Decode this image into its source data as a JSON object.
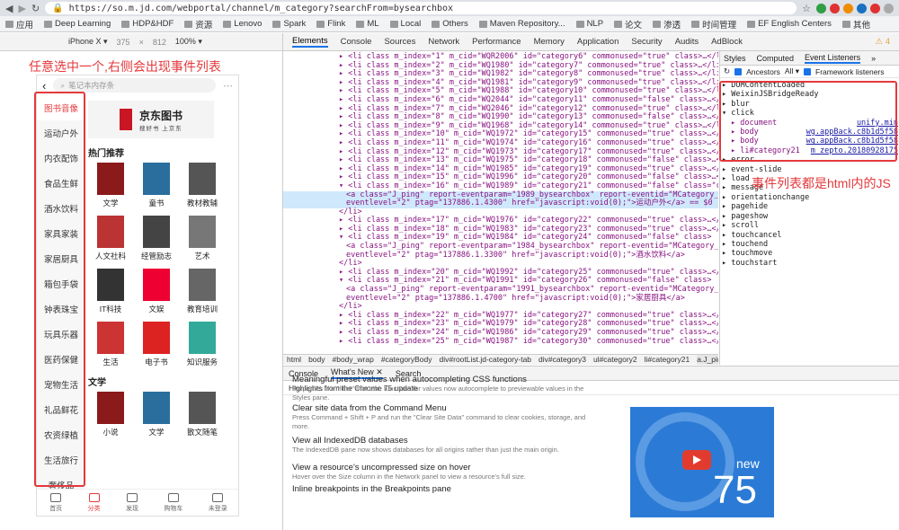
{
  "browser": {
    "url": "https://so.m.jd.com/webportal/channel/m_category?searchFrom=bysearchbox"
  },
  "bookmarks": [
    "应用",
    "Deep Learning",
    "HDP&HDF",
    "资源",
    "Lenovo",
    "Spark",
    "Flink",
    "ML",
    "Local",
    "Others",
    "Maven Repository...",
    "NLP",
    "论文",
    "渗透",
    "时间管理",
    "EF English Centers",
    "其他"
  ],
  "device": {
    "name": "iPhone X ▾",
    "width": "375",
    "height": "812",
    "zoom": "100% ▾"
  },
  "annotations": {
    "left": "任意选中一个,右侧会出现事件列表",
    "right": "事件列表都是html内的JS"
  },
  "phone": {
    "search_placeholder": "笔记本内存条",
    "categories": [
      "图书音像",
      "运动户外",
      "内衣配饰",
      "食品生鲜",
      "酒水饮料",
      "家具家装",
      "家居厨具",
      "箱包手袋",
      "钟表珠宝",
      "玩具乐器",
      "医药保健",
      "宠物生活",
      "礼品鲜花",
      "农资绿植",
      "生活旅行",
      "奢侈品"
    ],
    "banner_title": "京东图书",
    "banner_sub": "搜好书 上京东",
    "hot_title": "热门推荐",
    "hot_items": [
      "文学",
      "童书",
      "教材教辅",
      "人文社科",
      "经管励志",
      "艺术",
      "IT科技",
      "文娱",
      "教育培训",
      "生活",
      "电子书",
      "知识服务"
    ],
    "lit_title": "文学",
    "lit_items": [
      "小说",
      "文学",
      "散文随笔"
    ],
    "tabbar": [
      "首页",
      "分类",
      "发现",
      "购物车",
      "未登录"
    ]
  },
  "devtools": {
    "tabs": [
      "Elements",
      "Console",
      "Sources",
      "Network",
      "Performance",
      "Memory",
      "Application",
      "Security",
      "Audits",
      "AdBlock"
    ],
    "warn": "⚠ 4",
    "styles_tabs": [
      "Styles",
      "Computed",
      "Event Listeners",
      "»"
    ],
    "ancestors_label": "Ancestors",
    "all_label": "All ▾",
    "framework_label": "Framework listeners",
    "events": [
      "DOMContentLoaded",
      "WeixinJSBridgeReady",
      "blur",
      "click"
    ],
    "click_subs": [
      {
        "el": "document",
        "src": "unify.min"
      },
      {
        "el": "body",
        "src": "wg.appBack.c8b1d5f58"
      },
      {
        "el": "body",
        "src": "wg.appBack.c8b1d5f58"
      },
      {
        "el": "li#category21",
        "src": "m_zepto.20180928175"
      }
    ],
    "events_after": [
      "error",
      "event-slide",
      "load",
      "message",
      "orientationchange",
      "pagehide",
      "pageshow",
      "scroll",
      "touchcancel",
      "touchend",
      "touchmove",
      "touchstart"
    ],
    "crumbs": [
      "html",
      "body",
      "#body_wrap",
      "#categoryBody",
      "div#rootList.jd-category-tab",
      "div#category3",
      "ul#category2",
      "li#category21",
      "a.J_ping"
    ],
    "drawer_tabs": [
      "Console",
      "What's New ✕",
      "Search"
    ],
    "highlights": "Highlights from the Chrome 75 update",
    "items": [
      {
        "t": "Meaningful preset values when autocompleting CSS functions",
        "d": "Properties like \"filter\" that take functions for values now autocomplete to previewable values in the Styles pane."
      },
      {
        "t": "Clear site data from the Command Menu",
        "d": "Press Command + Shift + P and run the \"Clear Site Data\" command to clear cookies, storage, and more."
      },
      {
        "t": "View all IndexedDB databases",
        "d": "The IndexedDB pane now shows databases for all origins rather than just the main origin."
      },
      {
        "t": "View a resource's uncompressed size on hover",
        "d": "Hover over the Size column in the Network panel to view a resource's full size."
      },
      {
        "t": "Inline breakpoints in the Breakpoints pane",
        "d": ""
      }
    ],
    "promo_new": "new",
    "promo_ver": "75"
  }
}
